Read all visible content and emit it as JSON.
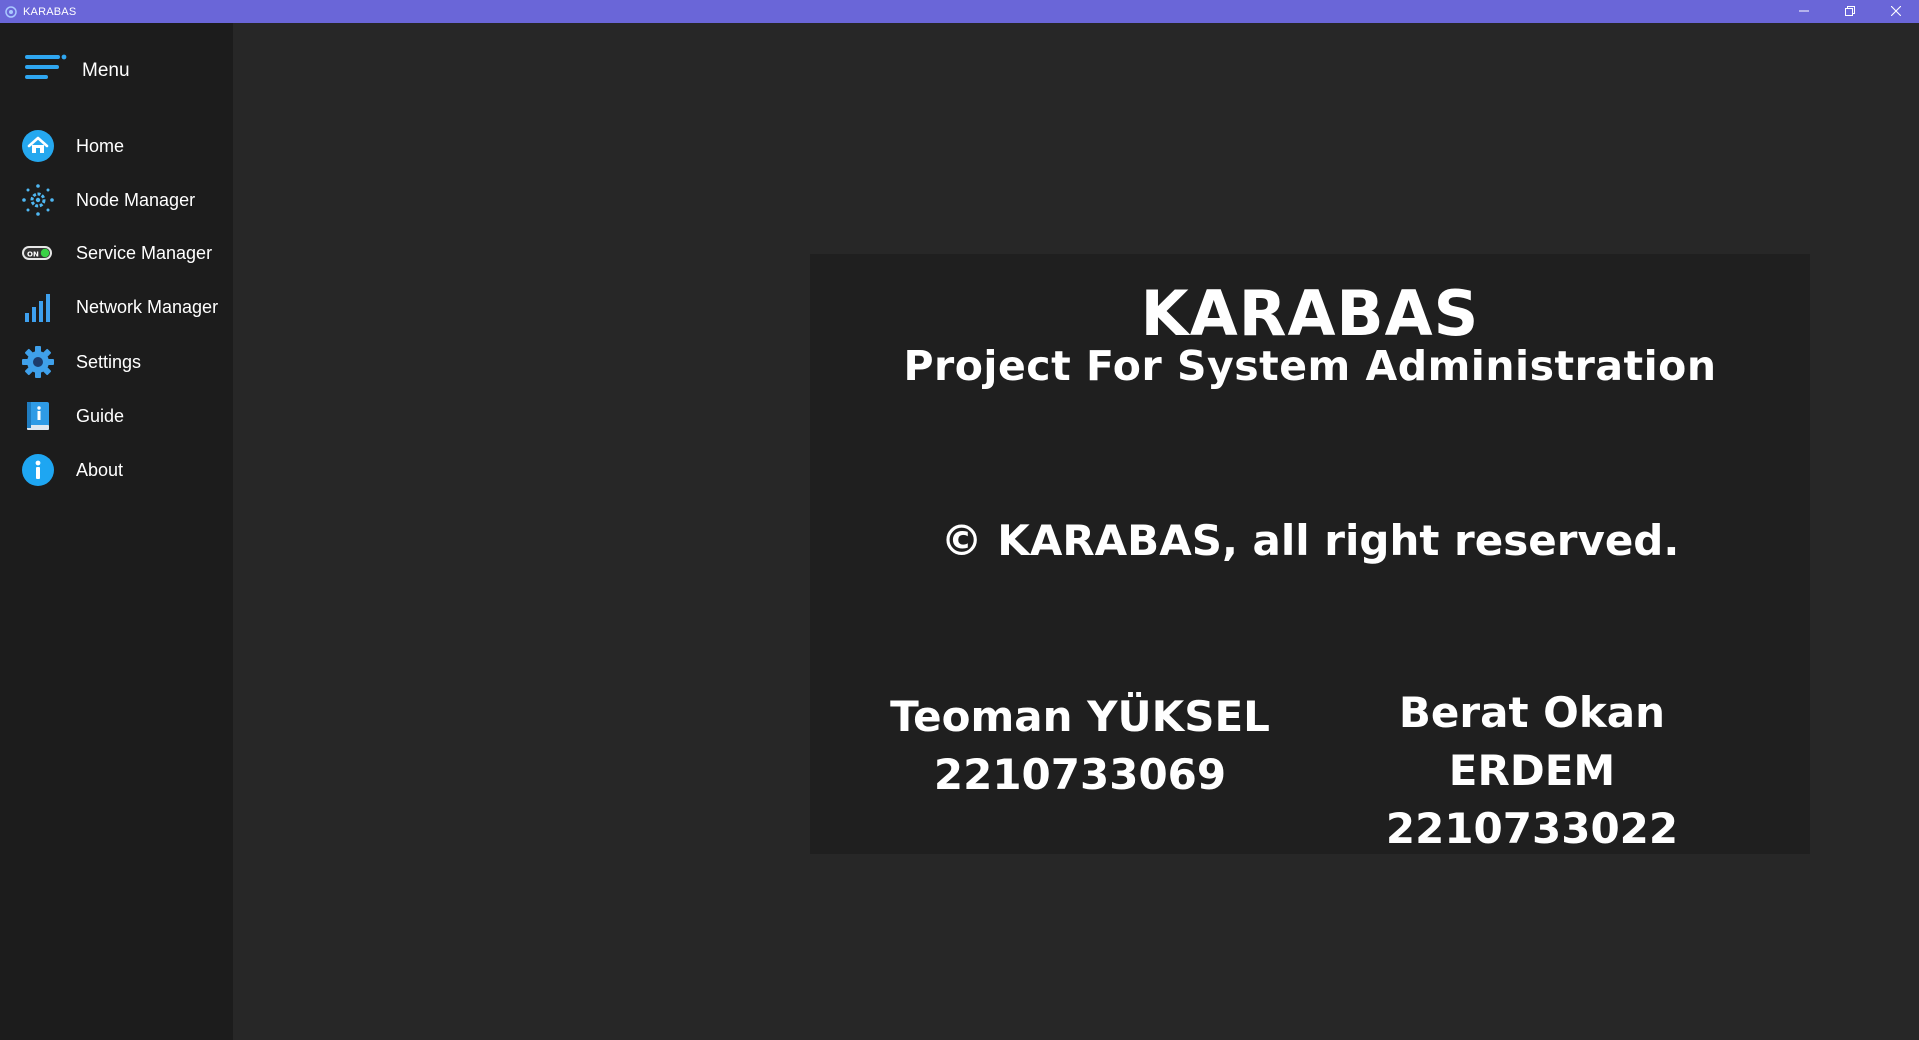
{
  "window": {
    "title": "KARABAS",
    "accent_color": "#6a66d8",
    "controls": [
      "minimize-icon",
      "restore-icon",
      "close-icon"
    ]
  },
  "sidebar": {
    "menu_label": "Menu",
    "items": [
      {
        "label": "Home",
        "icon": "home-icon"
      },
      {
        "label": "Node Manager",
        "icon": "node-gear-icon"
      },
      {
        "label": "Service Manager",
        "icon": "toggle-on-icon"
      },
      {
        "label": "Network Manager",
        "icon": "signal-bars-icon"
      },
      {
        "label": "Settings",
        "icon": "settings-gear-icon"
      },
      {
        "label": "Guide",
        "icon": "guide-book-icon"
      },
      {
        "label": "About",
        "icon": "info-icon"
      }
    ]
  },
  "about": {
    "app_name": "KARABAS",
    "subtitle": "Project For System Administration",
    "copyright": "© KARABAS, all right reserved.",
    "authors": [
      {
        "name": "Teoman YÜKSEL",
        "id": "2210733069"
      },
      {
        "name": "Berat Okan ERDEM",
        "id": "2210733022"
      }
    ]
  }
}
